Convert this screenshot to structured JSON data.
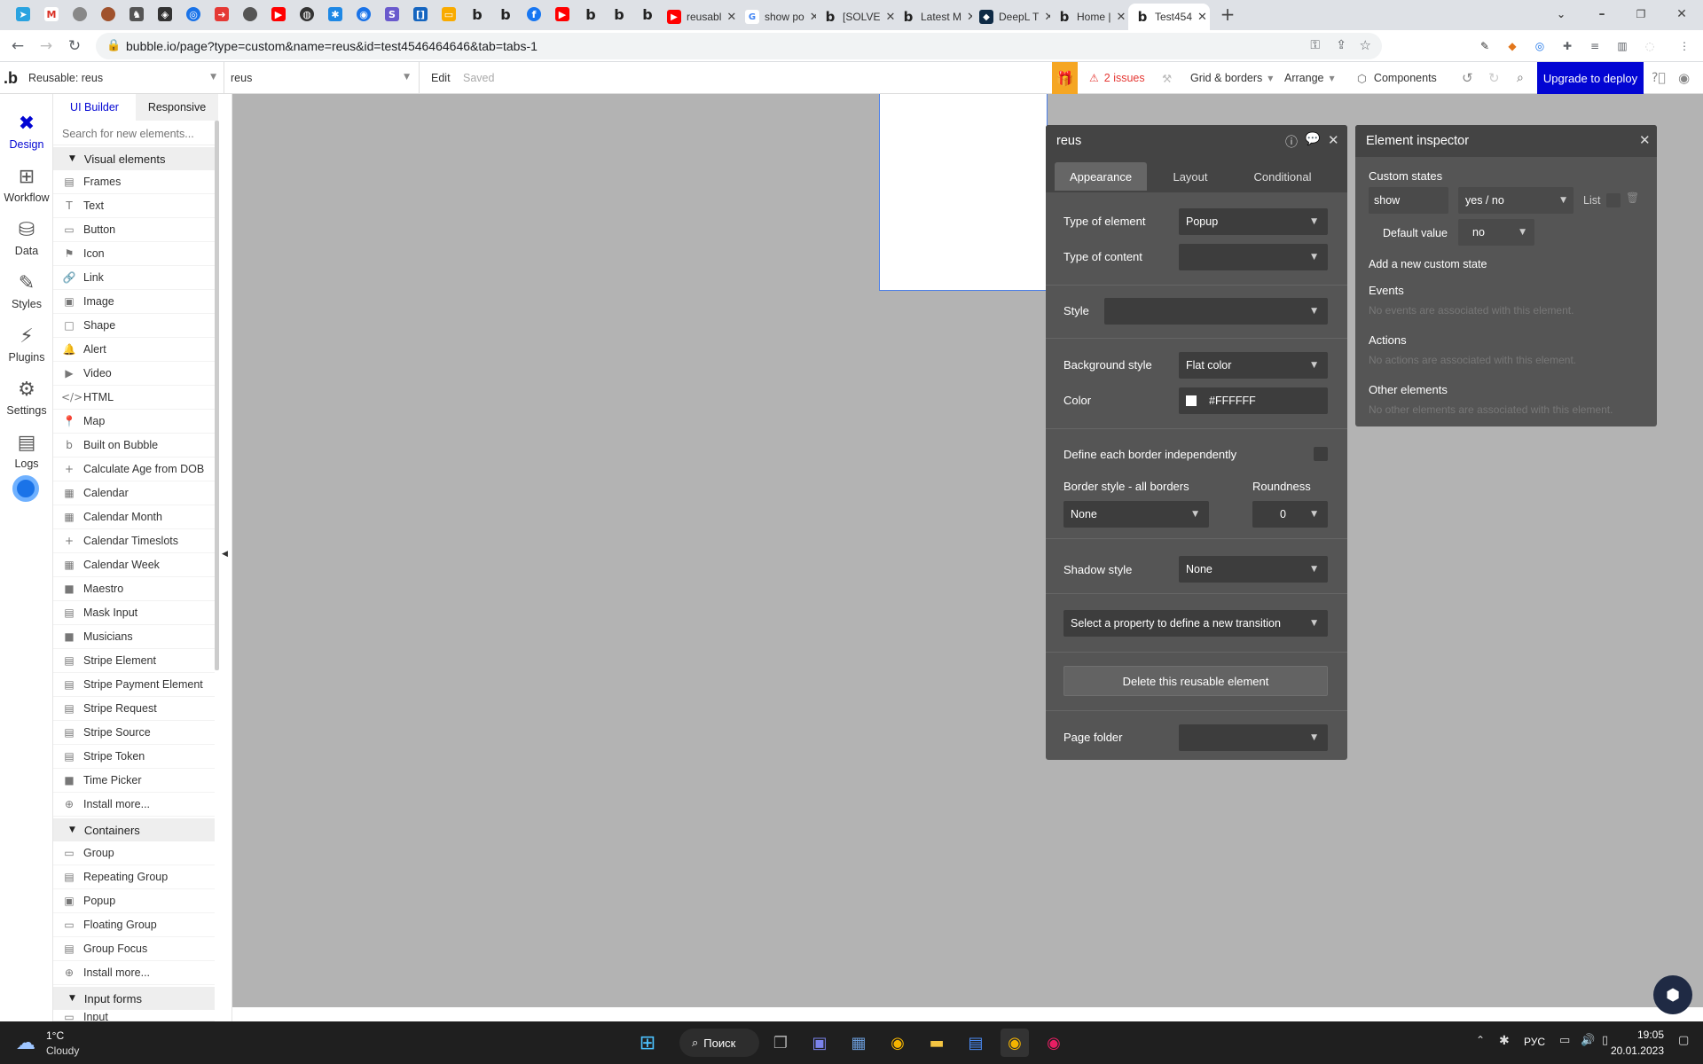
{
  "browser": {
    "tabs": [
      {
        "title": "reusabl",
        "icon": "youtube-icon",
        "color": "#ff0000"
      },
      {
        "title": "show po",
        "icon": "google-icon",
        "color": "#4285f4"
      },
      {
        "title": "[SOLVE",
        "icon": "bubble-icon",
        "color": "#222222"
      },
      {
        "title": "Latest M",
        "icon": "bubble-icon",
        "color": "#222222"
      },
      {
        "title": "DeepL T",
        "icon": "deepl-icon",
        "color": "#0f2b46"
      },
      {
        "title": "Home |",
        "icon": "bubble-icon",
        "color": "#222222"
      },
      {
        "title": "Test454",
        "icon": "bubble-icon",
        "color": "#222222"
      }
    ],
    "url": "bubble.io/page?type=custom&name=reus&id=test4546464646&tab=tabs-1"
  },
  "topbar": {
    "reusable_label": "Reusable: reus",
    "page_select": "reus",
    "edit": "Edit",
    "saved": "Saved",
    "issues": "2 issues",
    "grid": "Grid & borders",
    "arrange": "Arrange",
    "components": "Components",
    "upgrade": "Upgrade to deploy"
  },
  "rail": {
    "design": "Design",
    "workflow": "Workflow",
    "data": "Data",
    "styles": "Styles",
    "plugins": "Plugins",
    "settings": "Settings",
    "logs": "Logs"
  },
  "palette": {
    "tab_ui": "UI Builder",
    "tab_responsive": "Responsive",
    "search_placeholder": "Search for new elements...",
    "visual_header": "Visual elements",
    "visual": [
      {
        "label": "Frames",
        "icon": "▤"
      },
      {
        "label": "Text",
        "icon": "T"
      },
      {
        "label": "Button",
        "icon": "▭"
      },
      {
        "label": "Icon",
        "icon": "⚑"
      },
      {
        "label": "Link",
        "icon": "🔗"
      },
      {
        "label": "Image",
        "icon": "▣"
      },
      {
        "label": "Shape",
        "icon": "□"
      },
      {
        "label": "Alert",
        "icon": "🔔"
      },
      {
        "label": "Video",
        "icon": "▶"
      },
      {
        "label": "HTML",
        "icon": "</>"
      },
      {
        "label": "Map",
        "icon": "📍"
      },
      {
        "label": "Built on Bubble",
        "icon": "b"
      },
      {
        "label": "Calculate Age from DOB",
        "icon": "+"
      },
      {
        "label": "Calendar",
        "icon": "▦"
      },
      {
        "label": "Calendar Month",
        "icon": "▦"
      },
      {
        "label": "Calendar Timeslots",
        "icon": "+"
      },
      {
        "label": "Calendar Week",
        "icon": "▦"
      },
      {
        "label": "Maestro",
        "icon": "■"
      },
      {
        "label": "Mask Input",
        "icon": "▤"
      },
      {
        "label": "Musicians",
        "icon": "■"
      },
      {
        "label": "Stripe Element",
        "icon": "▤"
      },
      {
        "label": "Stripe Payment Element",
        "icon": "▤"
      },
      {
        "label": "Stripe Request",
        "icon": "▤"
      },
      {
        "label": "Stripe Source",
        "icon": "▤"
      },
      {
        "label": "Stripe Token",
        "icon": "▤"
      },
      {
        "label": "Time Picker",
        "icon": "■"
      },
      {
        "label": "Install more...",
        "icon": "⊕"
      }
    ],
    "containers_header": "Containers",
    "containers": [
      {
        "label": "Group",
        "icon": "▭"
      },
      {
        "label": "Repeating Group",
        "icon": "▤"
      },
      {
        "label": "Popup",
        "icon": "▣"
      },
      {
        "label": "Floating Group",
        "icon": "▭"
      },
      {
        "label": "Group Focus",
        "icon": "▤"
      },
      {
        "label": "Install more...",
        "icon": "⊕"
      }
    ],
    "inputs_header": "Input forms",
    "partial_item": "Input"
  },
  "editor": {
    "title": "reus",
    "tabs": [
      "Appearance",
      "Layout",
      "Conditional"
    ],
    "type_of_element_label": "Type of element",
    "type_of_element": "Popup",
    "type_of_content_label": "Type of content",
    "type_of_content": "",
    "style_label": "Style",
    "style": "",
    "background_style_label": "Background style",
    "background_style": "Flat color",
    "color_label": "Color",
    "color": "#FFFFFF",
    "border_indep_label": "Define each border independently",
    "border_style_label": "Border style - all borders",
    "border_style": "None",
    "roundness_label": "Roundness",
    "roundness": "0",
    "shadow_label": "Shadow style",
    "shadow": "None",
    "transition": "Select a property to define a new transition",
    "delete_button": "Delete this reusable element",
    "page_folder_label": "Page folder",
    "page_folder": ""
  },
  "inspector": {
    "title": "Element inspector",
    "custom_states": "Custom states",
    "state_name": "show",
    "state_type": "yes / no",
    "list": "List",
    "default_label": "Default value",
    "default_value": "no",
    "add_state": "Add a new custom state",
    "events": "Events",
    "events_empty": "No events are associated with this element.",
    "actions": "Actions",
    "actions_empty": "No actions are associated with this element.",
    "other": "Other elements",
    "other_empty": "No other elements are associated with this element."
  },
  "taskbar": {
    "temp": "1°C",
    "weather": "Cloudy",
    "search": "Поиск",
    "lang": "РУС",
    "time": "19:05",
    "date": "20.01.2023"
  }
}
